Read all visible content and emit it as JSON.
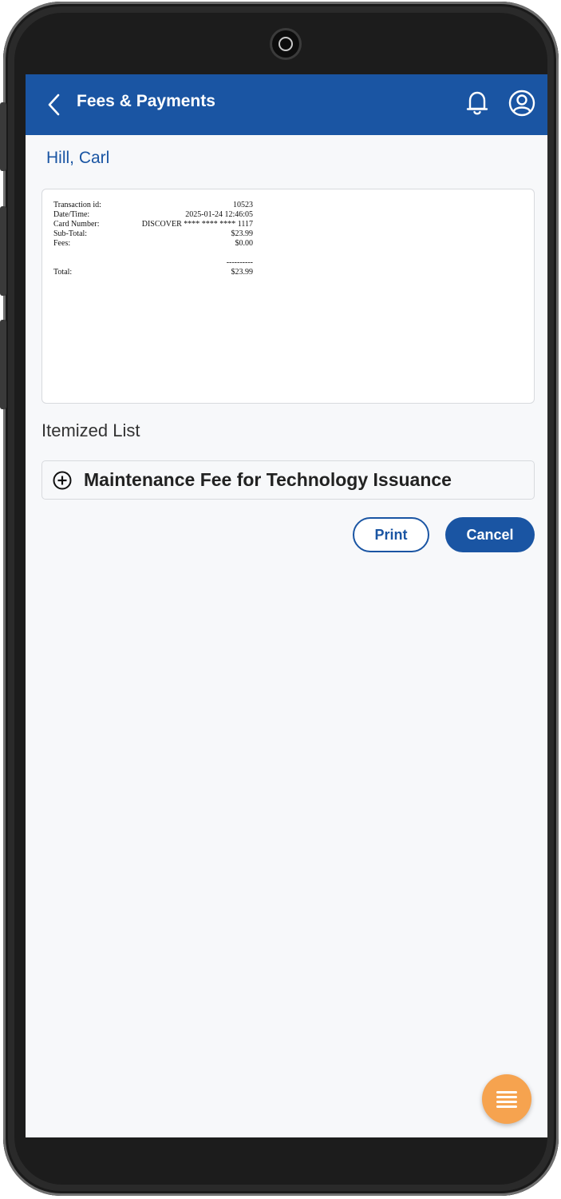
{
  "header": {
    "title": "Fees & Payments"
  },
  "customer": {
    "name": "Hill, Carl"
  },
  "receipt": {
    "transaction_label": "Transaction id:",
    "transaction_value": "10523",
    "datetime_label": "Date/Time:",
    "datetime_value": "2025-01-24 12:46:05",
    "card_label": "Card Number:",
    "card_value": "DISCOVER **** **** **** 1117",
    "subtotal_label": "Sub-Total:",
    "subtotal_value": "$23.99",
    "fees_label": "Fees:",
    "fees_value": "$0.00",
    "divider": "----------",
    "total_label": "Total:",
    "total_value": "$23.99"
  },
  "itemized": {
    "title": "Itemized List",
    "items": [
      {
        "label": "Maintenance Fee for Technology Issuance"
      }
    ]
  },
  "actions": {
    "print_label": "Print",
    "cancel_label": "Cancel"
  },
  "icons": {
    "back": "chevron-left-icon",
    "notifications": "bell-icon",
    "account": "account-icon",
    "expand": "plus-circle-icon",
    "menu": "menu-icon"
  },
  "colors": {
    "primary": "#1a55a3",
    "fab": "#f6a34f",
    "background": "#f7f8fa"
  }
}
